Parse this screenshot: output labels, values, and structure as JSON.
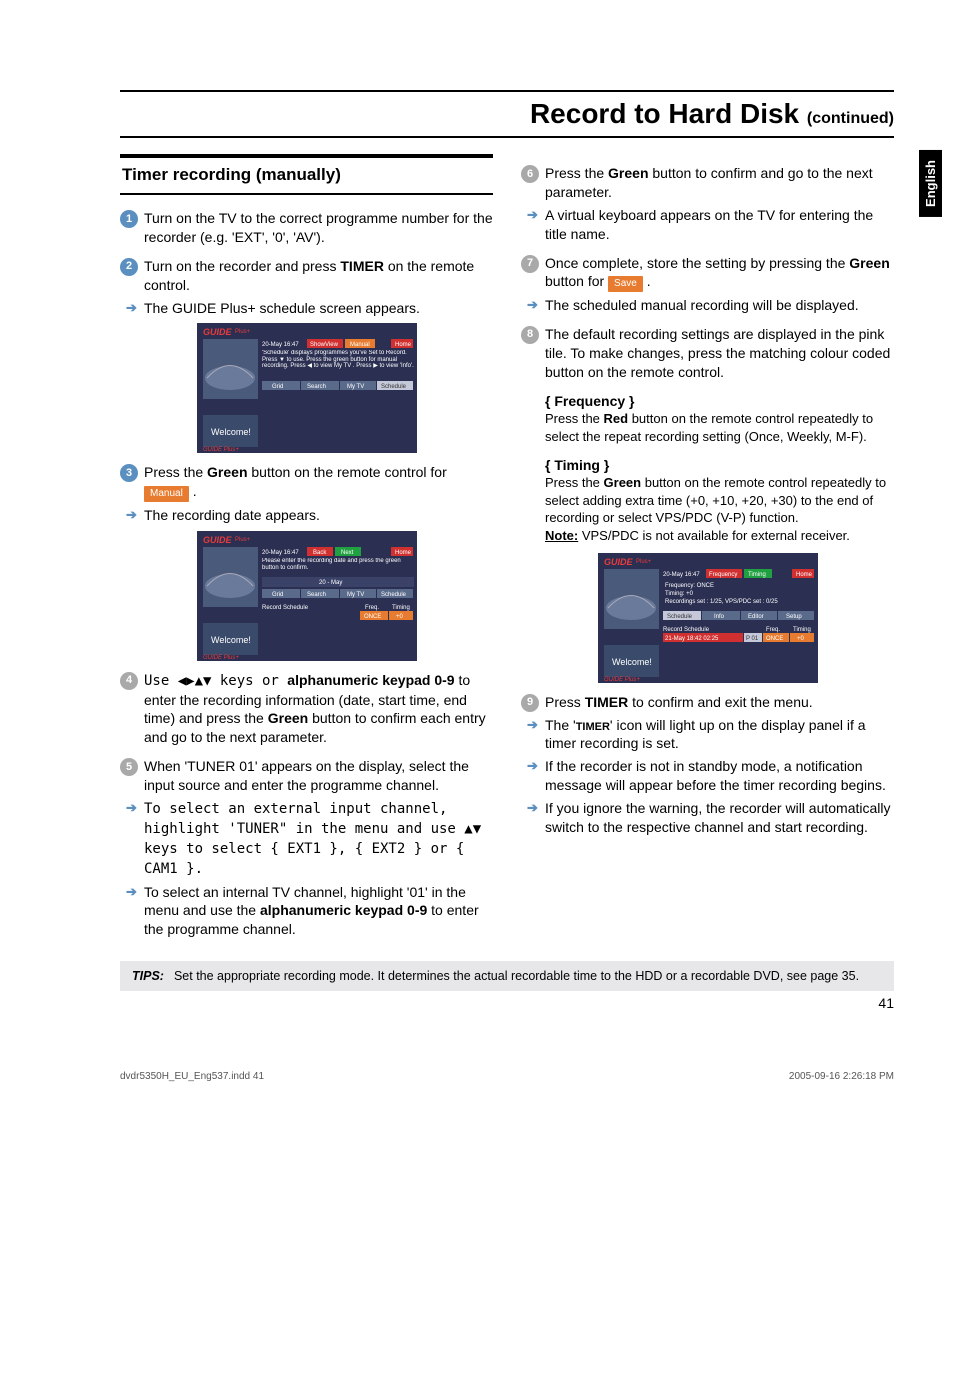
{
  "title_main": "Record to Hard Disk",
  "title_cont": "(continued)",
  "lang_tab": "English",
  "subhead": "Timer recording (manually)",
  "left": {
    "s1": "Turn on the TV to the correct programme number for the recorder (e.g. 'EXT', '0', 'AV').",
    "s2a": "Turn on the recorder and press ",
    "s2b": "TIMER",
    "s2c": " on the remote control.",
    "s2_res": "The GUIDE Plus+ schedule screen appears.",
    "s3a": "Press the ",
    "s3b": "Green",
    "s3c": " button on the remote control for ",
    "s3_tag": "Manual",
    "s3_res": "The recording date appears.",
    "s4a": "Use ◀▶▲▼ keys or ",
    "s4b": "alphanumeric keypad 0-9",
    "s4c": " to enter the recording information (date, start time, end time) and press the ",
    "s4d": "Green",
    "s4e": " button to confirm each entry and go to the next parameter.",
    "s5a": "When 'TUNER 01' appears on the display, select the input source and enter the programme channel.",
    "s5_res1a": "To select an external input channel, highlight 'TUNER\" in the menu and use ▲▼ keys to select { EXT1 }, { EXT2 } or { CAM1 }.",
    "s5_res2a": "To select an internal TV channel, highlight '01' in the menu and use the ",
    "s5_res2b": "alphanumeric keypad 0-9",
    "s5_res2c": " to enter the programme channel."
  },
  "right": {
    "s6a": "Press the ",
    "s6b": "Green",
    "s6c": " button to confirm and go to the next parameter.",
    "s6_res": "A virtual keyboard appears on the TV for entering the title name.",
    "s7a": "Once complete, store the setting by pressing the ",
    "s7b": "Green",
    "s7c": " button for ",
    "s7_tag": "Save",
    "s7_res": "The scheduled manual recording will be displayed.",
    "s8": "The default recording settings are displayed in the pink tile. To make changes, press the matching colour coded button on the remote control.",
    "freq_h": "{ Frequency }",
    "freq_b1": "Press the ",
    "freq_b2": "Red",
    "freq_b3": " button on the remote control repeatedly to select the repeat recording setting (Once, Weekly, M-F).",
    "tim_h": "{ Timing }",
    "tim_b1": "Press the ",
    "tim_b2": "Green",
    "tim_b3": " button on the remote control repeatedly to select adding extra time (+0, +10, +20, +30) to the end of recording or select VPS/PDC (V-P) function.",
    "tim_note_u": "Note:",
    "tim_note": " VPS/PDC is not available for external receiver.",
    "s9a": "Press ",
    "s9b": "TIMER",
    "s9c": " to confirm and exit the menu.",
    "s9_r1a": "The '",
    "s9_r1b": "TIMER",
    "s9_r1c": "' icon will light up on the display panel if a timer recording is set.",
    "s9_r2": "If the recorder is not in standby mode, a notification message will appear before the timer recording begins.",
    "s9_r3": "If you ignore the warning, the recorder will automatically switch to the respective channel and start recording."
  },
  "tips_label": "TIPS:",
  "tips_body": "Set the appropriate recording mode. It determines the actual recordable time to the HDD or a recordable DVD, see page 35.",
  "page_num": "41",
  "footer_left": "dvdr5350H_EU_Eng537.indd   41",
  "footer_right": "2005-09-16   2:26:18 PM",
  "shot1": {
    "date": "20-May  16:47",
    "showview": "ShowView",
    "manual": "Manual",
    "home": "Home",
    "desc": "'Schedule' displays programmes you've Set to Record. Press ▼ to use.  Press the green button for manual recording. Press ◀ to view My TV .  Press ▶ to view 'Info'.",
    "grid": "Grid",
    "search": "Search",
    "mytv": "My TV",
    "schedule": "Schedule",
    "welcome": "Welcome!"
  },
  "shot2": {
    "date": "20-May  16:47",
    "back": "Back",
    "next": "Next",
    "home": "Home",
    "desc": "Please enter the recording date and press the green button to confirm.",
    "day": "20 - May",
    "grid": "Grid",
    "search": "Search",
    "mytv": "My TV",
    "schedule": "Schedule",
    "rs": "Record Schedule",
    "freq": "Freq.",
    "timing": "Timing",
    "once": "ONCE",
    "plus0": "+0",
    "welcome": "Welcome!"
  },
  "shot3": {
    "date": "20-May  16:47",
    "frequency": "Frequency",
    "timing": "Timing",
    "home": "Home",
    "l1": "Frequency: ONCE",
    "l2": "Timing:    +0",
    "l3": "Recordings set : 1/25,  VPS/PDC set : 0/25",
    "schedule": "Schedule",
    "info": "Info",
    "editor": "Editor",
    "setup": "Setup",
    "rs": "Record Schedule",
    "freq": "Freq.",
    "timingh": "Timing",
    "row": "21-May  18:42  02:25",
    "p": "P 01",
    "once": "ONCE",
    "plus0": "+0",
    "welcome": "Welcome!"
  }
}
